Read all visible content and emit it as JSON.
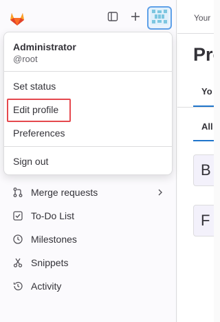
{
  "topbar": {
    "logo_icon": "gitlab-tanuki-icon",
    "toggle_icon": "sidebar-toggle-icon",
    "new_icon": "plus-icon",
    "avatar_icon": "user-avatar-identicon"
  },
  "dropdown": {
    "user_name": "Administrator",
    "username": "@root",
    "items": [
      {
        "label": "Set status"
      },
      {
        "label": "Edit profile"
      },
      {
        "label": "Preferences"
      },
      {
        "label": "Sign out"
      }
    ]
  },
  "sidebar": {
    "items": [
      {
        "label": "Merge requests",
        "icon": "merge-request-icon",
        "has_chevron": true
      },
      {
        "label": "To-Do List",
        "icon": "todo-checkbox-icon"
      },
      {
        "label": "Milestones",
        "icon": "clock-icon"
      },
      {
        "label": "Snippets",
        "icon": "scissors-icon"
      },
      {
        "label": "Activity",
        "icon": "history-icon"
      }
    ]
  },
  "main": {
    "breadcrumb": "Your",
    "title": "Pro",
    "tab": "Yo",
    "filter": "All",
    "cards": [
      "B",
      "F"
    ]
  },
  "colors": {
    "accent": "#1f75cb",
    "highlight_border": "#e5484d",
    "avatar_border": "#5ea0e8"
  }
}
